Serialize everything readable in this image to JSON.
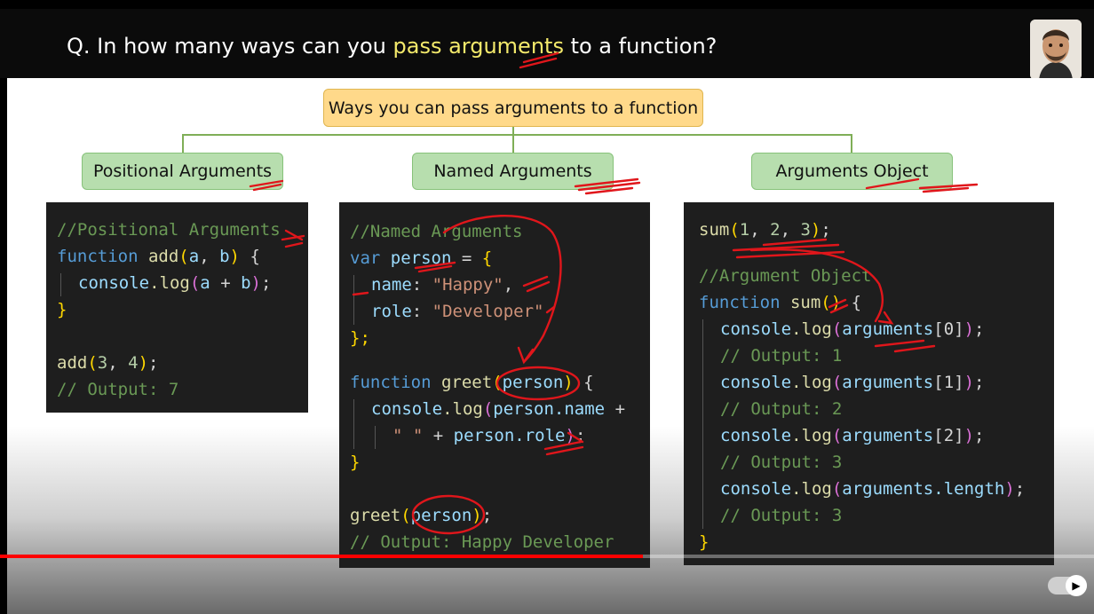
{
  "header": {
    "question_prefix": "Q. In how many ways can you ",
    "question_highlight": "pass arguments",
    "question_suffix": " to a function?"
  },
  "diagram": {
    "root": "Ways you can pass arguments to a function",
    "categories": [
      "Positional Arguments",
      "Named Arguments",
      "Arguments Object"
    ]
  },
  "positional_code": {
    "l1": "//Positional Arguments",
    "l2_kw": "function",
    "l2_fn": "add",
    "l2_p1": "(",
    "l2_a": "a",
    "l2_comma": ", ",
    "l2_b": "b",
    "l2_p2": ")",
    "l2_brace": " {",
    "l3_obj": "console",
    "l3_fn": ".log",
    "l3_p1": "(",
    "l3_a": "a",
    "l3_op": " + ",
    "l3_b": "b",
    "l3_p2": ")",
    "l3_semi": ";",
    "l4": "}",
    "l6_fn": "add",
    "l6_p1": "(",
    "l6_n1": "3",
    "l6_comma": ", ",
    "l6_n2": "4",
    "l6_p2": ")",
    "l6_semi": ";",
    "l7": "// Output: 7"
  },
  "named_code": {
    "l1": "//Named Arguments",
    "l2_kw": "var",
    "l2_v": "person",
    "l2_rest": " = ",
    "l2_brace": "{",
    "l3_key": "name",
    "l3_colon": ": ",
    "l3_val": "\"Happy\"",
    "l3_comma": ",",
    "l4_key": "role",
    "l4_colon": ": ",
    "l4_val": "\"Developer\"",
    "l5": "};",
    "l7_kw": "function",
    "l7_fn": "greet",
    "l7_p1": "(",
    "l7_v": "person",
    "l7_p2": ")",
    "l7_brace": " {",
    "l8_obj": "console",
    "l8_fn": ".log",
    "l8_p1": "(",
    "l8_v": "person.name",
    "l8_op": " +",
    "l9_s": "\" \"",
    "l9_op": " + ",
    "l9_v": "person.role",
    "l9_p2": ")",
    "l9_semi": ";",
    "l10": "}",
    "l12_fn": "greet",
    "l12_p1": "(",
    "l12_v": "person",
    "l12_p2": ")",
    "l12_semi": ";",
    "l13": "// Output: Happy Developer"
  },
  "args_code": {
    "l1_fn": "sum",
    "l1_p1": "(",
    "l1_n1": "1",
    "l1_c1": ", ",
    "l1_n2": "2",
    "l1_c2": ", ",
    "l1_n3": "3",
    "l1_p2": ")",
    "l1_semi": ";",
    "l3": "//Argument Object",
    "l4_kw": "function",
    "l4_fn": "sum",
    "l4_p": "()",
    "l4_brace": " {",
    "log_obj": "console",
    "log_fn": ".log",
    "p_open": "(",
    "p_close": ")",
    "semi": ";",
    "args": "arguments",
    "idx0": "[0]",
    "idx1": "[1]",
    "idx2": "[2]",
    "len": ".length",
    "out1": "// Output: 1",
    "out2": "// Output: 2",
    "out3": "// Output: 3",
    "out4": "// Output: 3",
    "close": "}"
  },
  "video": {
    "progress_fraction": 0.588
  },
  "colors": {
    "highlight": "#f3e96b",
    "topic_box": "#ffd98a",
    "category_box": "#b7deae",
    "connector": "#7fae57",
    "annotation_ink": "#e0161b",
    "progress": "#ff0000"
  }
}
